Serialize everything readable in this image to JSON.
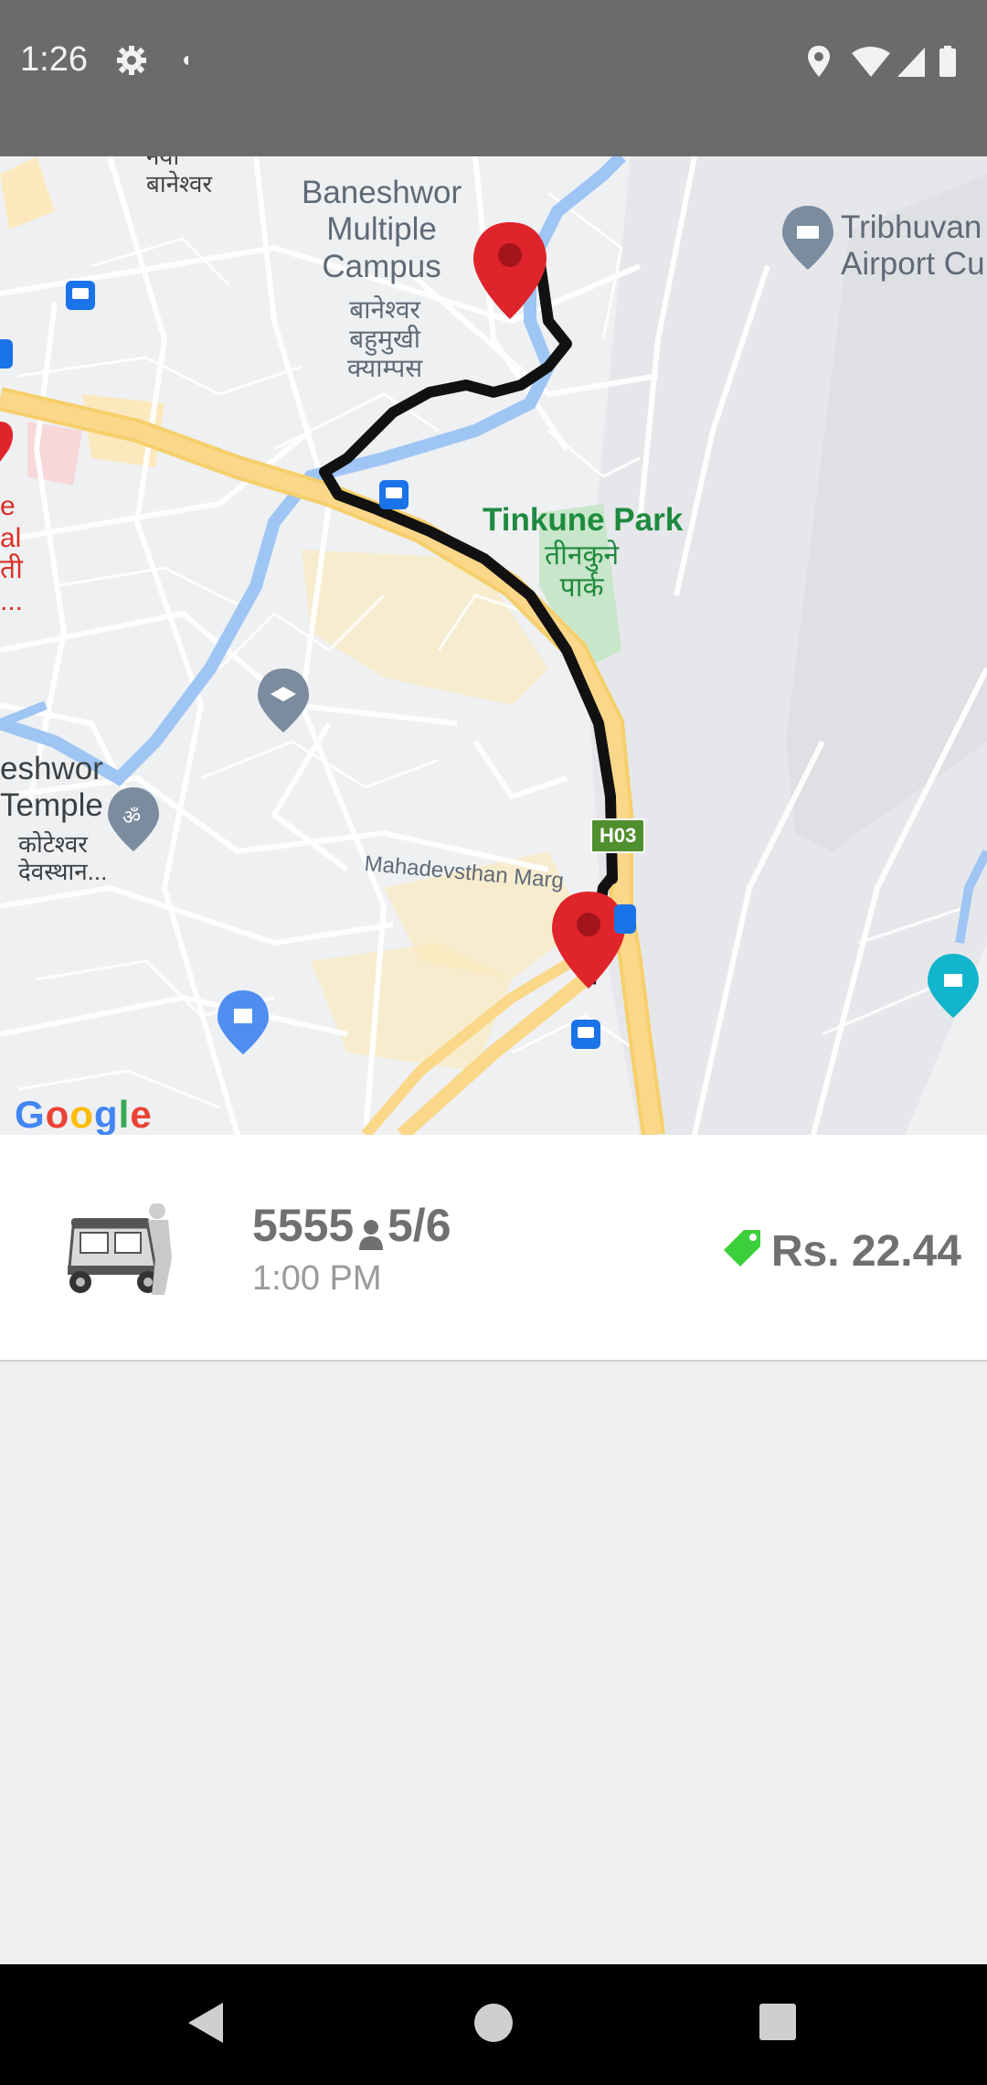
{
  "status_bar": {
    "time": "1:26",
    "left_icons": [
      "settings-icon",
      "notification-dot-icon"
    ],
    "right_icons": [
      "location-icon",
      "wifi-icon",
      "signal-icon",
      "battery-icon"
    ]
  },
  "map": {
    "provider_logo": "Google",
    "labels": {
      "top_devanagari": "नया\nबानेश्वर",
      "campus": "Baneshwor\nMultiple\nCampus",
      "campus_devanagari": "बानेश्वर\nबहुमुखी\nक्याम्पस",
      "airport": "Tribhuvan\nAirport Cu",
      "park": "Tinkune Park",
      "park_devanagari": "तीनकुने\nपार्क",
      "temple": "eshwor\nTemple",
      "temple_devanagari": "कोटेश्वर\nदेवस्थान...",
      "road": "Mahadevsthan Marg",
      "road_badge": "H03",
      "left_red": "e\nal\nती\n..."
    }
  },
  "trip": {
    "trip_id": "5555",
    "seats": "5/6",
    "time": "1:00 PM",
    "fare": "Rs. 22.44",
    "fare_icon_color": "#3ccf3c"
  },
  "nav_bar": {
    "buttons": [
      "back-icon",
      "home-icon",
      "recents-icon"
    ]
  }
}
